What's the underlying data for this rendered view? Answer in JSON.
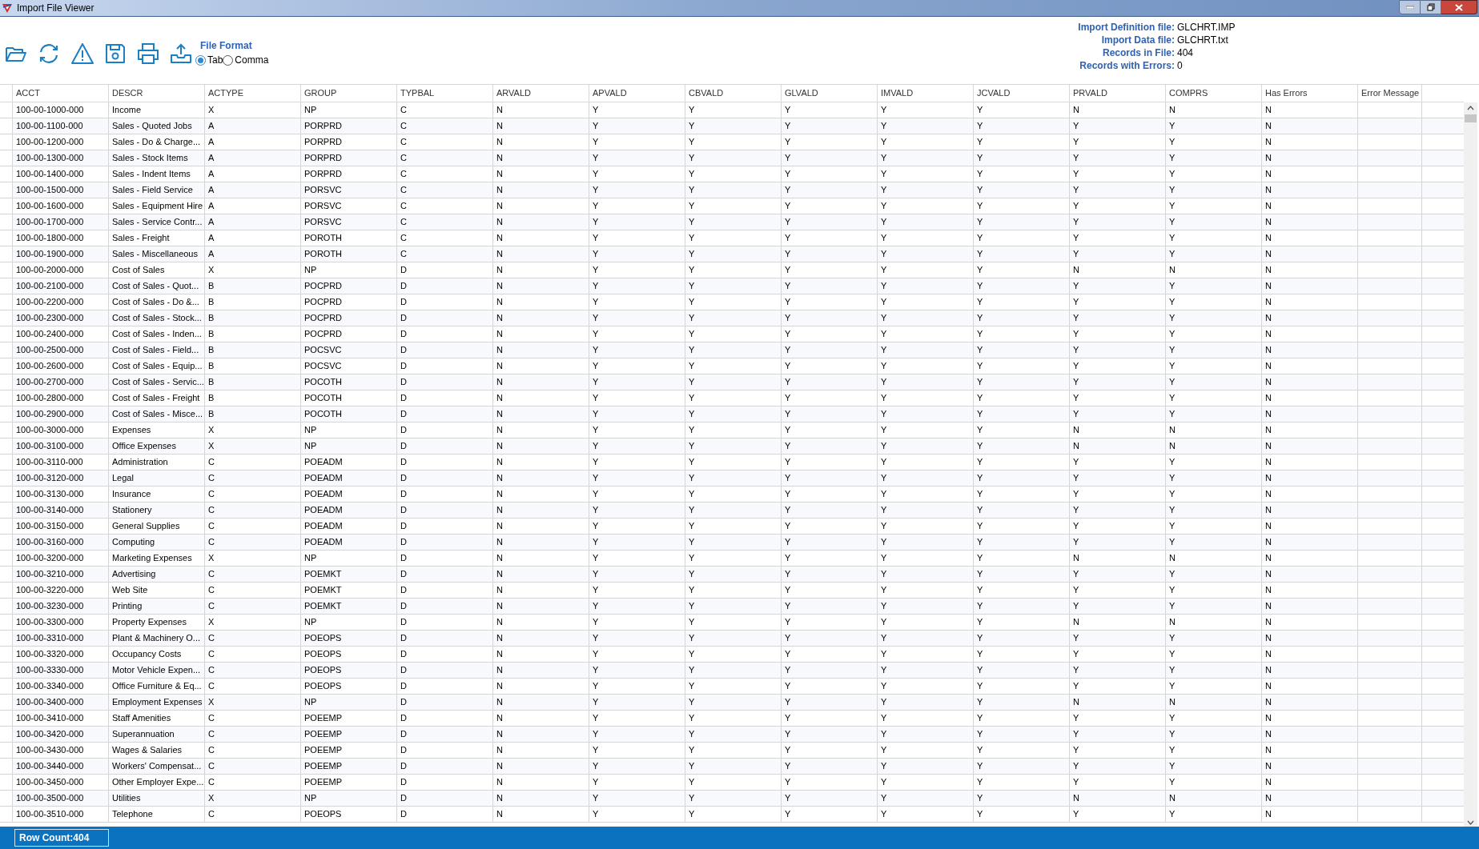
{
  "window": {
    "title": "Import File Viewer"
  },
  "toolbar": {
    "file_format": {
      "label": "File Format",
      "options": [
        {
          "label": "Tab",
          "selected": true
        },
        {
          "label": "Comma",
          "selected": false
        }
      ]
    }
  },
  "info": [
    {
      "label": "Import Definition file:",
      "value": "GLCHRT.IMP"
    },
    {
      "label": "Import Data file:",
      "value": "GLCHRT.txt"
    },
    {
      "label": "Records in File:",
      "value": "404"
    },
    {
      "label": "Records with Errors:",
      "value": "0"
    }
  ],
  "table": {
    "columns": [
      "ACCT",
      "DESCR",
      "ACTYPE",
      "GROUP",
      "TYPBAL",
      "ARVALD",
      "APVALD",
      "CBVALD",
      "GLVALD",
      "IMVALD",
      "JCVALD",
      "PRVALD",
      "COMPRS",
      "Has Errors",
      "Error Message"
    ],
    "rows": [
      [
        "100-00-1000-000",
        "Income",
        "X",
        "NP",
        "C",
        "N",
        "Y",
        "Y",
        "Y",
        "Y",
        "Y",
        "N",
        "N",
        "N"
      ],
      [
        "100-00-1100-000",
        "Sales - Quoted Jobs",
        "A",
        "PORPRD",
        "C",
        "N",
        "Y",
        "Y",
        "Y",
        "Y",
        "Y",
        "Y",
        "Y",
        "N"
      ],
      [
        "100-00-1200-000",
        "Sales - Do & Charge...",
        "A",
        "PORPRD",
        "C",
        "N",
        "Y",
        "Y",
        "Y",
        "Y",
        "Y",
        "Y",
        "Y",
        "N"
      ],
      [
        "100-00-1300-000",
        "Sales - Stock Items",
        "A",
        "PORPRD",
        "C",
        "N",
        "Y",
        "Y",
        "Y",
        "Y",
        "Y",
        "Y",
        "Y",
        "N"
      ],
      [
        "100-00-1400-000",
        "Sales - Indent Items",
        "A",
        "PORPRD",
        "C",
        "N",
        "Y",
        "Y",
        "Y",
        "Y",
        "Y",
        "Y",
        "Y",
        "N"
      ],
      [
        "100-00-1500-000",
        "Sales - Field Service",
        "A",
        "PORSVC",
        "C",
        "N",
        "Y",
        "Y",
        "Y",
        "Y",
        "Y",
        "Y",
        "Y",
        "N"
      ],
      [
        "100-00-1600-000",
        "Sales - Equipment Hire",
        "A",
        "PORSVC",
        "C",
        "N",
        "Y",
        "Y",
        "Y",
        "Y",
        "Y",
        "Y",
        "Y",
        "N"
      ],
      [
        "100-00-1700-000",
        "Sales - Service Contr...",
        "A",
        "PORSVC",
        "C",
        "N",
        "Y",
        "Y",
        "Y",
        "Y",
        "Y",
        "Y",
        "Y",
        "N"
      ],
      [
        "100-00-1800-000",
        "Sales - Freight",
        "A",
        "POROTH",
        "C",
        "N",
        "Y",
        "Y",
        "Y",
        "Y",
        "Y",
        "Y",
        "Y",
        "N"
      ],
      [
        "100-00-1900-000",
        "Sales - Miscellaneous",
        "A",
        "POROTH",
        "C",
        "N",
        "Y",
        "Y",
        "Y",
        "Y",
        "Y",
        "Y",
        "Y",
        "N"
      ],
      [
        "100-00-2000-000",
        "Cost of Sales",
        "X",
        "NP",
        "D",
        "N",
        "Y",
        "Y",
        "Y",
        "Y",
        "Y",
        "N",
        "N",
        "N"
      ],
      [
        "100-00-2100-000",
        "Cost of Sales - Quot...",
        "B",
        "POCPRD",
        "D",
        "N",
        "Y",
        "Y",
        "Y",
        "Y",
        "Y",
        "Y",
        "Y",
        "N"
      ],
      [
        "100-00-2200-000",
        "Cost of Sales - Do &...",
        "B",
        "POCPRD",
        "D",
        "N",
        "Y",
        "Y",
        "Y",
        "Y",
        "Y",
        "Y",
        "Y",
        "N"
      ],
      [
        "100-00-2300-000",
        "Cost of Sales - Stock...",
        "B",
        "POCPRD",
        "D",
        "N",
        "Y",
        "Y",
        "Y",
        "Y",
        "Y",
        "Y",
        "Y",
        "N"
      ],
      [
        "100-00-2400-000",
        "Cost of Sales - Inden...",
        "B",
        "POCPRD",
        "D",
        "N",
        "Y",
        "Y",
        "Y",
        "Y",
        "Y",
        "Y",
        "Y",
        "N"
      ],
      [
        "100-00-2500-000",
        "Cost of Sales - Field...",
        "B",
        "POCSVC",
        "D",
        "N",
        "Y",
        "Y",
        "Y",
        "Y",
        "Y",
        "Y",
        "Y",
        "N"
      ],
      [
        "100-00-2600-000",
        "Cost of Sales - Equip...",
        "B",
        "POCSVC",
        "D",
        "N",
        "Y",
        "Y",
        "Y",
        "Y",
        "Y",
        "Y",
        "Y",
        "N"
      ],
      [
        "100-00-2700-000",
        "Cost of Sales - Servic...",
        "B",
        "POCOTH",
        "D",
        "N",
        "Y",
        "Y",
        "Y",
        "Y",
        "Y",
        "Y",
        "Y",
        "N"
      ],
      [
        "100-00-2800-000",
        "Cost of Sales - Freight",
        "B",
        "POCOTH",
        "D",
        "N",
        "Y",
        "Y",
        "Y",
        "Y",
        "Y",
        "Y",
        "Y",
        "N"
      ],
      [
        "100-00-2900-000",
        "Cost of Sales - Misce...",
        "B",
        "POCOTH",
        "D",
        "N",
        "Y",
        "Y",
        "Y",
        "Y",
        "Y",
        "Y",
        "Y",
        "N"
      ],
      [
        "100-00-3000-000",
        "Expenses",
        "X",
        "NP",
        "D",
        "N",
        "Y",
        "Y",
        "Y",
        "Y",
        "Y",
        "N",
        "N",
        "N"
      ],
      [
        "100-00-3100-000",
        "Office Expenses",
        "X",
        "NP",
        "D",
        "N",
        "Y",
        "Y",
        "Y",
        "Y",
        "Y",
        "N",
        "N",
        "N"
      ],
      [
        "100-00-3110-000",
        "Administration",
        "C",
        "POEADM",
        "D",
        "N",
        "Y",
        "Y",
        "Y",
        "Y",
        "Y",
        "Y",
        "Y",
        "N"
      ],
      [
        "100-00-3120-000",
        "Legal",
        "C",
        "POEADM",
        "D",
        "N",
        "Y",
        "Y",
        "Y",
        "Y",
        "Y",
        "Y",
        "Y",
        "N"
      ],
      [
        "100-00-3130-000",
        "Insurance",
        "C",
        "POEADM",
        "D",
        "N",
        "Y",
        "Y",
        "Y",
        "Y",
        "Y",
        "Y",
        "Y",
        "N"
      ],
      [
        "100-00-3140-000",
        "Stationery",
        "C",
        "POEADM",
        "D",
        "N",
        "Y",
        "Y",
        "Y",
        "Y",
        "Y",
        "Y",
        "Y",
        "N"
      ],
      [
        "100-00-3150-000",
        "General Supplies",
        "C",
        "POEADM",
        "D",
        "N",
        "Y",
        "Y",
        "Y",
        "Y",
        "Y",
        "Y",
        "Y",
        "N"
      ],
      [
        "100-00-3160-000",
        "Computing",
        "C",
        "POEADM",
        "D",
        "N",
        "Y",
        "Y",
        "Y",
        "Y",
        "Y",
        "Y",
        "Y",
        "N"
      ],
      [
        "100-00-3200-000",
        "Marketing Expenses",
        "X",
        "NP",
        "D",
        "N",
        "Y",
        "Y",
        "Y",
        "Y",
        "Y",
        "N",
        "N",
        "N"
      ],
      [
        "100-00-3210-000",
        "Advertising",
        "C",
        "POEMKT",
        "D",
        "N",
        "Y",
        "Y",
        "Y",
        "Y",
        "Y",
        "Y",
        "Y",
        "N"
      ],
      [
        "100-00-3220-000",
        "Web Site",
        "C",
        "POEMKT",
        "D",
        "N",
        "Y",
        "Y",
        "Y",
        "Y",
        "Y",
        "Y",
        "Y",
        "N"
      ],
      [
        "100-00-3230-000",
        "Printing",
        "C",
        "POEMKT",
        "D",
        "N",
        "Y",
        "Y",
        "Y",
        "Y",
        "Y",
        "Y",
        "Y",
        "N"
      ],
      [
        "100-00-3300-000",
        "Property Expenses",
        "X",
        "NP",
        "D",
        "N",
        "Y",
        "Y",
        "Y",
        "Y",
        "Y",
        "N",
        "N",
        "N"
      ],
      [
        "100-00-3310-000",
        "Plant & Machinery O...",
        "C",
        "POEOPS",
        "D",
        "N",
        "Y",
        "Y",
        "Y",
        "Y",
        "Y",
        "Y",
        "Y",
        "N"
      ],
      [
        "100-00-3320-000",
        "Occupancy Costs",
        "C",
        "POEOPS",
        "D",
        "N",
        "Y",
        "Y",
        "Y",
        "Y",
        "Y",
        "Y",
        "Y",
        "N"
      ],
      [
        "100-00-3330-000",
        "Motor Vehicle Expen...",
        "C",
        "POEOPS",
        "D",
        "N",
        "Y",
        "Y",
        "Y",
        "Y",
        "Y",
        "Y",
        "Y",
        "N"
      ],
      [
        "100-00-3340-000",
        "Office Furniture & Eq...",
        "C",
        "POEOPS",
        "D",
        "N",
        "Y",
        "Y",
        "Y",
        "Y",
        "Y",
        "Y",
        "Y",
        "N"
      ],
      [
        "100-00-3400-000",
        "Employment Expenses",
        "X",
        "NP",
        "D",
        "N",
        "Y",
        "Y",
        "Y",
        "Y",
        "Y",
        "N",
        "N",
        "N"
      ],
      [
        "100-00-3410-000",
        "Staff Amenities",
        "C",
        "POEEMP",
        "D",
        "N",
        "Y",
        "Y",
        "Y",
        "Y",
        "Y",
        "Y",
        "Y",
        "N"
      ],
      [
        "100-00-3420-000",
        "Superannuation",
        "C",
        "POEEMP",
        "D",
        "N",
        "Y",
        "Y",
        "Y",
        "Y",
        "Y",
        "Y",
        "Y",
        "N"
      ],
      [
        "100-00-3430-000",
        "Wages & Salaries",
        "C",
        "POEEMP",
        "D",
        "N",
        "Y",
        "Y",
        "Y",
        "Y",
        "Y",
        "Y",
        "Y",
        "N"
      ],
      [
        "100-00-3440-000",
        "Workers' Compensat...",
        "C",
        "POEEMP",
        "D",
        "N",
        "Y",
        "Y",
        "Y",
        "Y",
        "Y",
        "Y",
        "Y",
        "N"
      ],
      [
        "100-00-3450-000",
        "Other Employer Expe...",
        "C",
        "POEEMP",
        "D",
        "N",
        "Y",
        "Y",
        "Y",
        "Y",
        "Y",
        "Y",
        "Y",
        "N"
      ],
      [
        "100-00-3500-000",
        "Utilities",
        "X",
        "NP",
        "D",
        "N",
        "Y",
        "Y",
        "Y",
        "Y",
        "Y",
        "N",
        "N",
        "N"
      ],
      [
        "100-00-3510-000",
        "Telephone",
        "C",
        "POEOPS",
        "D",
        "N",
        "Y",
        "Y",
        "Y",
        "Y",
        "Y",
        "Y",
        "Y",
        "N"
      ]
    ]
  },
  "status_bar": {
    "row_count": "Row Count:404"
  }
}
